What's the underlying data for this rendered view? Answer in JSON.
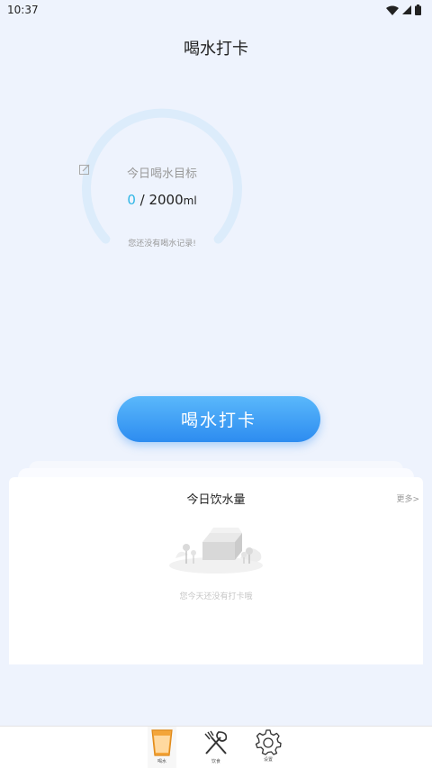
{
  "status_bar": {
    "time": "10:37"
  },
  "page": {
    "title": "喝水打卡"
  },
  "progress": {
    "goal_label": "今日喝水目标",
    "current_ml": "0",
    "separator": " / ",
    "target": "2000",
    "unit": "ml",
    "hint": "您还没有喝水记录!",
    "fraction": 0,
    "ring_color": "#dcecfb",
    "value_color": "#2fb6e6"
  },
  "checkin_button": {
    "label": "喝水打卡",
    "color": "#2d8cf0"
  },
  "intake_card": {
    "title": "今日饮水量",
    "more_label": "更多>",
    "empty_text": "您今天还没有打卡哦"
  },
  "tab_bar": {
    "tabs": [
      {
        "label": "喝水",
        "icon": "water-cup-icon",
        "active": true
      },
      {
        "label": "饮食",
        "icon": "fork-spoon-icon",
        "active": false
      },
      {
        "label": "设置",
        "icon": "gear-icon",
        "active": false
      }
    ]
  }
}
